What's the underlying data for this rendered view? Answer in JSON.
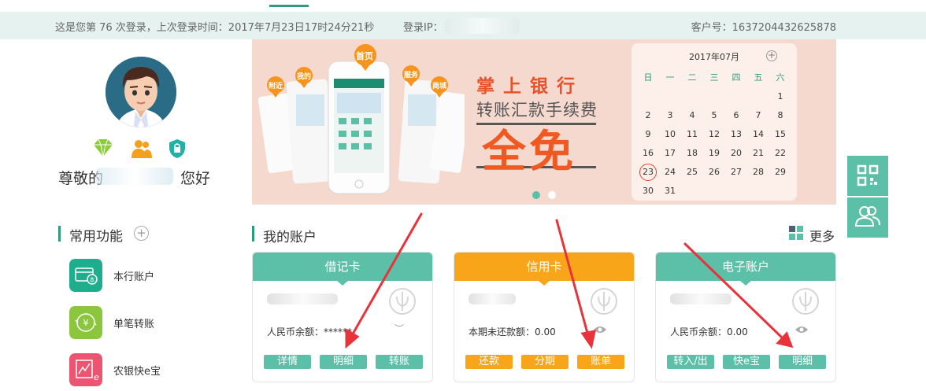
{
  "header": {
    "login_info": "这是您第 76 次登录，上次登录时间：2017年7月23日17时24分21秒",
    "ip_label": "登录IP：",
    "customer_no": "客户号：1637204432625878"
  },
  "user": {
    "greeting_prefix": "尊敬的",
    "greeting_suffix": "您好"
  },
  "common_functions": {
    "title": "常用功能",
    "items": [
      {
        "label": "本行账户",
        "icon": "bank-card-icon",
        "color": "#1fae8d"
      },
      {
        "label": "单笔转账",
        "icon": "transfer-yen-icon",
        "color": "#8cc63e"
      },
      {
        "label": "农银快e宝",
        "icon": "kuai-e-bao-icon",
        "color": "#ec5572"
      }
    ]
  },
  "banner": {
    "phone_tags": [
      "附近",
      "我的",
      "首页",
      "服务",
      "商城"
    ],
    "line1": "掌上银行",
    "line2": "转账汇款手续费",
    "line3": "全免",
    "calendar": {
      "title": "2017年07月",
      "weekdays": [
        "日",
        "一",
        "二",
        "三",
        "四",
        "五",
        "六"
      ],
      "weeks": [
        [
          "",
          "",
          "",
          "",
          "",
          "",
          "1"
        ],
        [
          "2",
          "3",
          "4",
          "5",
          "6",
          "7",
          "8"
        ],
        [
          "9",
          "10",
          "11",
          "12",
          "13",
          "14",
          "15"
        ],
        [
          "16",
          "17",
          "18",
          "19",
          "20",
          "21",
          "22"
        ],
        [
          "23",
          "24",
          "25",
          "26",
          "27",
          "28",
          "29"
        ],
        [
          "30",
          "31",
          "",
          "",
          "",
          "",
          ""
        ]
      ],
      "today": "23"
    }
  },
  "accounts": {
    "title": "我的账户",
    "more_label": "更多",
    "cards": [
      {
        "title": "借记卡",
        "balance": "人民币余额：******",
        "buttons": [
          "详情",
          "明细",
          "转账"
        ],
        "color": "#5cbfa7",
        "btn_color": "#5cbfa7",
        "eye": "hidden"
      },
      {
        "title": "信用卡",
        "balance": "本期未还款额：0.00",
        "buttons": [
          "还款",
          "分期",
          "账单"
        ],
        "color": "#f9a51a",
        "btn_color": "#f9a51a",
        "eye": "visible"
      },
      {
        "title": "电子账户",
        "balance": "人民币余额：0.00",
        "buttons": [
          "转入/出",
          "快e宝",
          "明细"
        ],
        "color": "#5cbfa7",
        "btn_color": "#5cbfa7",
        "eye": "visible"
      }
    ]
  },
  "colors": {
    "primary": "#2c9b7e",
    "accent_red": "#e8333a",
    "orange": "#f9a51a"
  }
}
